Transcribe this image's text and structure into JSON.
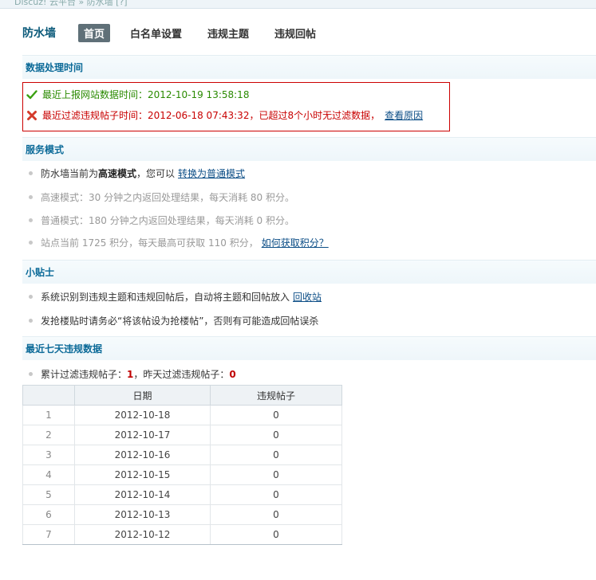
{
  "topstrip": "Discuz! 云平台 » 防水墙 [?]",
  "brand": "防水墙",
  "tabs": [
    "首页",
    "白名单设置",
    "违规主题",
    "违规回帖"
  ],
  "sections": {
    "processing": "数据处理时间",
    "service": "服务模式",
    "tips": "小贴士",
    "recent": "最近七天违规数据"
  },
  "alerts": {
    "ok_text": "最近上报网站数据时间：2012-10-19 13:58:18",
    "bad_text": "最近过滤违规帖子时间：2012-06-18 07:43:32，已超过8个小时无过滤数据，",
    "bad_link": "查看原因",
    "ok_color": "#2a8a00",
    "bad_color": "#c80000"
  },
  "service": {
    "line1_pre": "防水墙当前为",
    "line1_mode": "高速模式",
    "line1_post": "，您可以",
    "line1_link": "转换为普通模式",
    "line2": "高速模式：30 分钟之内返回处理结果，每天消耗 80 积分。",
    "line3": "普通模式：180 分钟之内返回处理结果，每天消耗 0 积分。",
    "line4": "站点当前 1725 积分，每天最高可获取 110 积分，",
    "line4_link": "如何获取积分？"
  },
  "tips": {
    "line1": "系统识别到违规主题和违规回帖后，自动将主题和回帖放入",
    "line1_link": "回收站",
    "line2": "发抢楼贴时请务必“将该帖设为抢楼帖”，否则有可能造成回帖误杀"
  },
  "recent": {
    "summary_pre": "累计过滤违规帖子：",
    "total": "1",
    "summary_mid": "，昨天过滤违规帖子：",
    "yesterday": "0"
  },
  "table": {
    "headers": [
      "",
      "日期",
      "违规帖子"
    ],
    "rows": [
      [
        "1",
        "2012-10-18",
        "0"
      ],
      [
        "2",
        "2012-10-17",
        "0"
      ],
      [
        "3",
        "2012-10-16",
        "0"
      ],
      [
        "4",
        "2012-10-15",
        "0"
      ],
      [
        "5",
        "2012-10-14",
        "0"
      ],
      [
        "6",
        "2012-10-13",
        "0"
      ],
      [
        "7",
        "2012-10-12",
        "0"
      ]
    ]
  }
}
